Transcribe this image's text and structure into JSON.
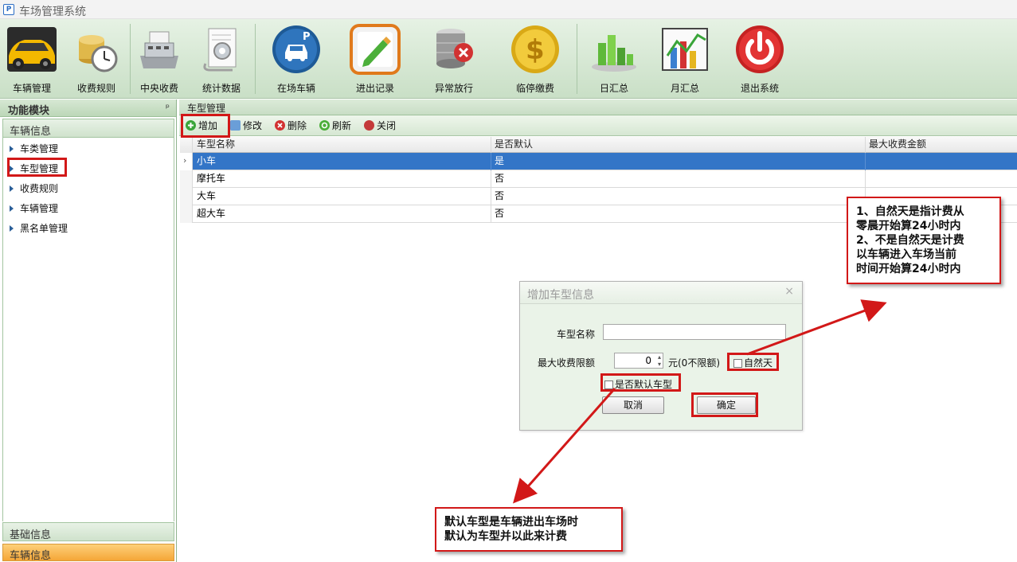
{
  "app": {
    "title": "车场管理系统",
    "icon_label": "P"
  },
  "toolbar": {
    "items": [
      {
        "label": "车辆管理",
        "icon": "sports-car-icon"
      },
      {
        "label": "收费规则",
        "icon": "coins-clock-icon"
      },
      {
        "label": "中央收费",
        "icon": "cash-register-icon"
      },
      {
        "label": "统计数据",
        "icon": "report-gear-icon"
      },
      {
        "label": "在场车辆",
        "icon": "parking-car-icon"
      },
      {
        "label": "进出记录",
        "icon": "edit-pen-icon"
      },
      {
        "label": "异常放行",
        "icon": "database-error-icon"
      },
      {
        "label": "临停缴费",
        "icon": "dollar-coin-icon"
      },
      {
        "label": "日汇总",
        "icon": "bar-chart-icon"
      },
      {
        "label": "月汇总",
        "icon": "line-bar-chart-icon"
      },
      {
        "label": "退出系统",
        "icon": "power-icon"
      }
    ]
  },
  "left_panel": {
    "title": "功能模块",
    "pin": "ᵖ",
    "section_vehicle": "车辆信息",
    "items": [
      "车类管理",
      "车型管理",
      "收费规则",
      "车辆管理",
      "黑名单管理"
    ],
    "section_basic": "基础信息",
    "section_vehicle_bottom": "车辆信息"
  },
  "main": {
    "tab": "车型管理",
    "actions": {
      "add": "增加",
      "edit": "修改",
      "delete": "删除",
      "refresh": "刷新",
      "close": "关闭"
    },
    "grid": {
      "columns": [
        "车型名称",
        "是否默认",
        "最大收费金额"
      ],
      "rows": [
        [
          "小车",
          "是",
          ""
        ],
        [
          "摩托车",
          "否",
          ""
        ],
        [
          "大车",
          "否",
          ""
        ],
        [
          "超大车",
          "否",
          ""
        ]
      ]
    }
  },
  "dialog": {
    "title": "增加车型信息",
    "close": "×",
    "name_label": "车型名称",
    "name_value": "",
    "max_label": "最大收费限额",
    "max_value": "0",
    "unit_label": "元(0不限额)",
    "natural_day_label": "自然天",
    "default_label": "是否默认车型",
    "cancel_label": "取消",
    "ok_label": "确定"
  },
  "notes": {
    "natural_day": [
      "1、自然天是指计费从",
      "零晨开始算24小时内",
      "2、不是自然天是计费",
      "以车辆进入车场当前",
      "时间开始算24小时内"
    ],
    "default_type": [
      "默认车型是车辆进出车场时",
      "默认为车型并以此来计费"
    ]
  },
  "colors": {
    "selection": "#3375c7",
    "highlight": "#d21818",
    "toolbar_bg": "#d6e8d3"
  }
}
